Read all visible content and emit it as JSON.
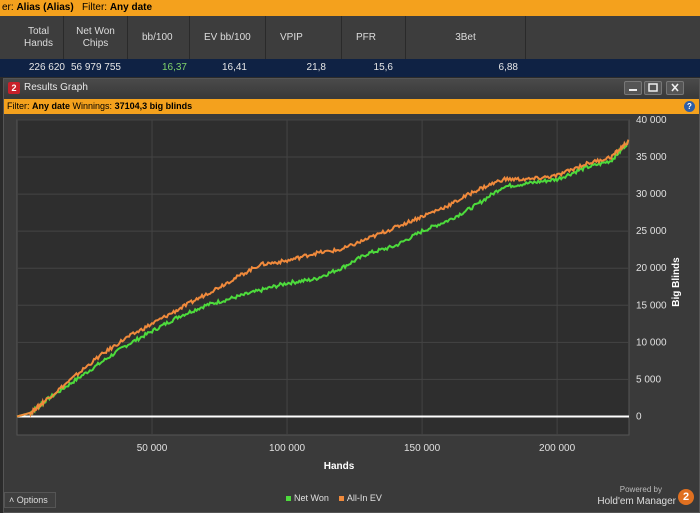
{
  "topbar": {
    "player_label": "er:",
    "player": "Alias (Alias)",
    "filter_label": "Filter:",
    "filter": "Any date"
  },
  "stats": {
    "headers": [
      "Total Hands",
      "Net Won Chips",
      "bb/100",
      "EV bb/100",
      "VPIP",
      "PFR",
      "3Bet"
    ],
    "row": [
      "226 620",
      "56 979 755",
      "16,37",
      "16,41",
      "21,8",
      "15,6",
      "6,88"
    ],
    "highlight_color": "#7fd36b"
  },
  "window": {
    "title": "Results Graph",
    "app_icon": "2",
    "filter_label": "Filter:",
    "filter_value": "Any date",
    "winnings_label": "Winnings:",
    "winnings_value": "37104,3 big blinds",
    "help_icon": "?"
  },
  "chart_data": {
    "type": "line",
    "xlabel": "Hands",
    "ylabel": "Big Blinds",
    "xlim": [
      0,
      226620
    ],
    "ylim": [
      -2500,
      40000
    ],
    "x_ticks": [
      50000,
      100000,
      150000,
      200000
    ],
    "x_tick_labels": [
      "50 000",
      "100 000",
      "150 000",
      "200 000"
    ],
    "y_ticks": [
      0,
      5000,
      10000,
      15000,
      20000,
      25000,
      30000,
      35000,
      40000
    ],
    "y_tick_labels": [
      "0",
      "5 000",
      "10 000",
      "15 000",
      "20 000",
      "25 000",
      "30 000",
      "35 000",
      "40 000"
    ],
    "grid": true,
    "legend_position": "bottom",
    "series": [
      {
        "name": "Net Won",
        "color": "#4ddb3c",
        "x": [
          0,
          5000,
          10000,
          20000,
          30000,
          40000,
          50000,
          60000,
          70000,
          80000,
          90000,
          100000,
          110000,
          120000,
          130000,
          140000,
          150000,
          160000,
          170000,
          180000,
          190000,
          200000,
          210000,
          220000,
          226620
        ],
        "y": [
          0,
          500,
          2000,
          4500,
          7000,
          9500,
          11500,
          13500,
          15000,
          16000,
          17000,
          18000,
          18500,
          20000,
          22000,
          23000,
          25000,
          26500,
          28500,
          31000,
          31500,
          32000,
          33500,
          34500,
          37104
        ]
      },
      {
        "name": "All-In EV",
        "color": "#f08a3c",
        "x": [
          0,
          5000,
          10000,
          20000,
          30000,
          40000,
          50000,
          60000,
          70000,
          80000,
          90000,
          100000,
          110000,
          120000,
          130000,
          140000,
          150000,
          160000,
          170000,
          180000,
          190000,
          200000,
          210000,
          220000,
          226620
        ],
        "y": [
          0,
          500,
          2000,
          5000,
          8000,
          10500,
          12500,
          14500,
          16500,
          18500,
          20500,
          21000,
          22000,
          22500,
          24000,
          25500,
          27000,
          28500,
          30500,
          32000,
          32000,
          32500,
          34000,
          35000,
          37200
        ]
      }
    ]
  },
  "legend": [
    {
      "label": "Net Won",
      "color": "#4ddb3c"
    },
    {
      "label": "All-In EV",
      "color": "#f08a3c"
    }
  ],
  "options_label": "Options",
  "brand": {
    "powered": "Powered by",
    "name": "Hold'em Manager",
    "logo": "2"
  }
}
